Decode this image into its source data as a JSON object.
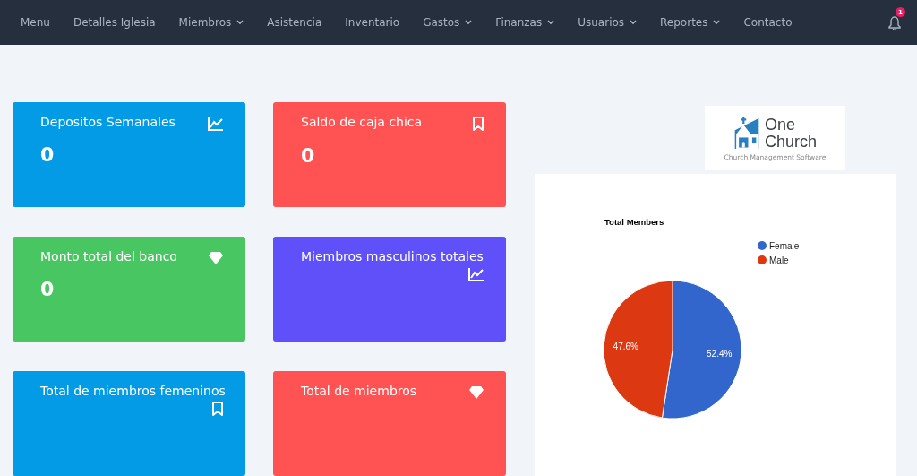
{
  "nav": {
    "items": [
      {
        "label": "Menu",
        "dropdown": false
      },
      {
        "label": "Detalles Iglesia",
        "dropdown": false
      },
      {
        "label": "Miembros",
        "dropdown": true
      },
      {
        "label": "Asistencia",
        "dropdown": false
      },
      {
        "label": "Inventario",
        "dropdown": false
      },
      {
        "label": "Gastos",
        "dropdown": true
      },
      {
        "label": "Finanzas",
        "dropdown": true
      },
      {
        "label": "Usuarios",
        "dropdown": true
      },
      {
        "label": "Reportes",
        "dropdown": true
      },
      {
        "label": "Contacto",
        "dropdown": false
      }
    ],
    "notification_count": "1"
  },
  "cards": [
    {
      "title": "Depositos Semanales",
      "value": "0",
      "kind": "chart",
      "color": "#039be5"
    },
    {
      "title": "Saldo de caja chica",
      "value": "0",
      "kind": "bookmark",
      "color": "#ff5252"
    },
    {
      "title": "Monto total del banco",
      "value": "0",
      "kind": "diamond",
      "color": "#48c662"
    },
    {
      "title": "Miembros masculinos totales",
      "kind": "chart",
      "color": "#5f50fa"
    },
    {
      "title": "Total de miembros femeninos",
      "kind": "bookmark",
      "color": "#039be5"
    },
    {
      "title": "Total de miembros",
      "kind": "diamond",
      "color": "#ff5252"
    }
  ],
  "logo": {
    "name_line_1": "One",
    "name_line_2": "Church",
    "tagline": "Church Management Software"
  },
  "chart": {
    "chart_data": {
      "type": "pie",
      "title": "Total Members",
      "categories": [
        "Female",
        "Male"
      ],
      "values": [
        52.4,
        47.6
      ],
      "legend": "right",
      "colors": [
        "#3366cc",
        "#dc3912"
      ],
      "value_labels": [
        "52.4%",
        "47.6%"
      ]
    }
  }
}
